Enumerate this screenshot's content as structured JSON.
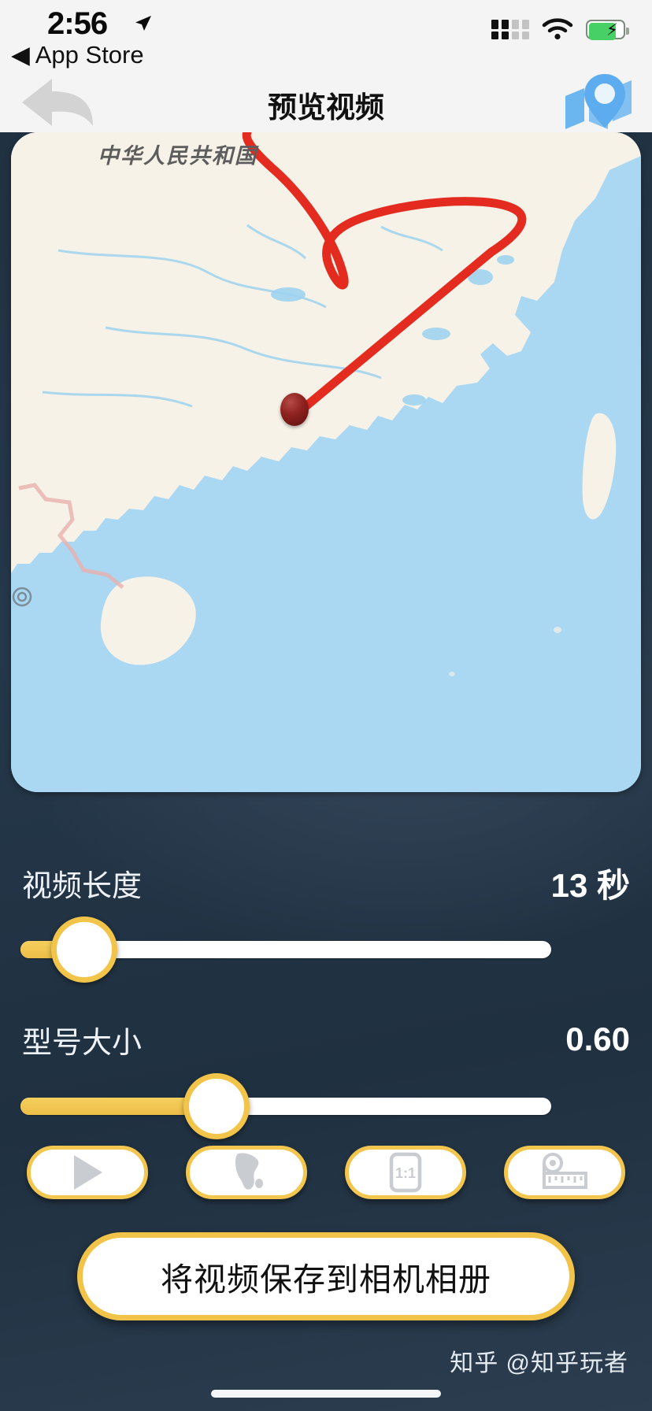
{
  "statusbar": {
    "time": "2:56",
    "back_label": "◀ App Store",
    "location_icon": "location-arrow-icon",
    "signal_icon": "cellular-signal-icon",
    "wifi_icon": "wifi-icon",
    "battery_icon": "battery-charging-icon",
    "battery_color": "#46d065"
  },
  "navbar": {
    "title": "预览视频",
    "back_icon": "back-arrow-icon",
    "map_icon": "map-pin-icon",
    "map_icon_color": "#6cb6ef",
    "background": "#f4f4f4"
  },
  "map": {
    "country_label": "中华人民共和国",
    "land_color": "#f6f2e8",
    "water_color": "#aad7f2",
    "route_color": "#e32b20",
    "marker_name": "route-start-marker",
    "marker_color": "#8e2220"
  },
  "controls": {
    "video_length": {
      "label": "视频长度",
      "value": "13 秒",
      "slider_percent": 12
    },
    "model_size": {
      "label": "型号大小",
      "value": "0.60",
      "slider_percent": 37
    },
    "accent_color": "#f2c44a",
    "track_color": "#ffffff"
  },
  "icon_buttons": [
    {
      "name": "play-button",
      "icon": "play-icon"
    },
    {
      "name": "map-style-button",
      "icon": "globe-map-icon"
    },
    {
      "name": "aspect-ratio-button",
      "icon": "one-to-one-icon"
    },
    {
      "name": "measure-button",
      "icon": "measuring-tape-icon"
    }
  ],
  "save_button": {
    "label": "将视频保存到相机相册"
  },
  "watermark": {
    "text": "知乎 @知乎玩者"
  },
  "home_indicator": {
    "name": "home-indicator"
  }
}
